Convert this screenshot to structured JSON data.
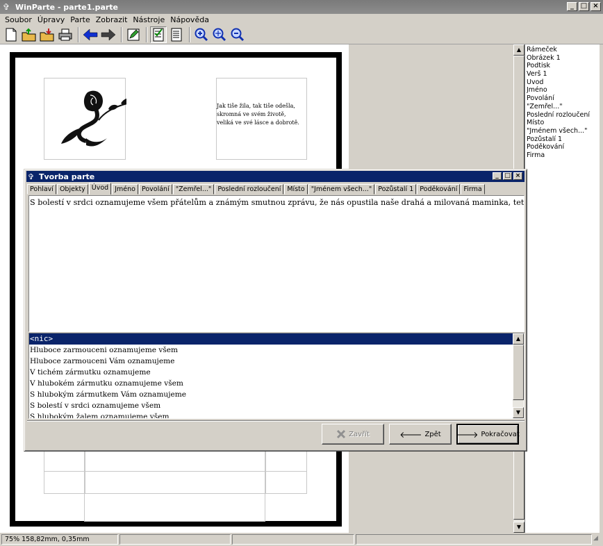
{
  "window": {
    "title": "WinParte - parte1.parte"
  },
  "menu": [
    "Soubor",
    "Úpravy",
    "Parte",
    "Zobrazit",
    "Nástroje",
    "Nápověda"
  ],
  "toolbar": {
    "icons": [
      "new-file-icon",
      "open-folder-icon",
      "save-folder-icon",
      "print-icon",
      "arrow-left-icon",
      "arrow-right-icon",
      "pencil-edit-icon",
      "checklist-icon",
      "document-list-icon",
      "zoom-in-icon",
      "zoom-fit-icon",
      "zoom-out-icon"
    ]
  },
  "page": {
    "poem": "Jak tiše žila, tak tiše odešla,\nskromná ve svém životě,\nveliká ve své lásce a dobrotě."
  },
  "right_list": [
    "Rámeček",
    "Obrázek 1",
    "Podtisk",
    "Verš 1",
    "Úvod",
    "Jméno",
    "Povolání",
    "\"Zemřel...\"",
    "Poslední rozloučení",
    "Místo",
    "\"Jménem všech...\"",
    "Pozůstalí 1",
    "Poděkování",
    "Firma"
  ],
  "status": {
    "zoom": "75% 158,82mm, 0,35mm",
    "p2": "",
    "p3": "",
    "p4": ""
  },
  "dialog": {
    "title": "Tvorba parte",
    "tabs": [
      "Pohlaví",
      "Objekty",
      "Úvod",
      "Jméno",
      "Povolání",
      "\"Zemřel...\"",
      "Poslední rozloučení",
      "Místo",
      "\"Jménem všech...\"",
      "Pozůstalí 1",
      "Poděkování",
      "Firma"
    ],
    "active_tab": "Úvod",
    "editor_text": "S bolestí v srdci oznamujeme všem přátelům a známým smutnou zprávu, že nás opustila naše drahá a milovaná maminka, teta, babička,",
    "phrases": [
      "<nic>",
      "Hluboce zarmouceni oznamujeme všem",
      "Hluboce zarmouceni Vám oznamujeme",
      "V tichém zármutku oznamujeme",
      "V hlubokém zármutku oznamujeme všem",
      "S hlubokým zármutkem Vám oznamujeme",
      "S bolestí v srdci oznamujeme všem",
      "S hlubokým žalem oznamujeme všem"
    ],
    "buttons": {
      "close": "Zavřít",
      "back": "Zpět",
      "next": "Pokračovat"
    }
  },
  "colors": {
    "selection": "#0a246a",
    "caret": "#e02020",
    "face": "#d4d0c8"
  }
}
